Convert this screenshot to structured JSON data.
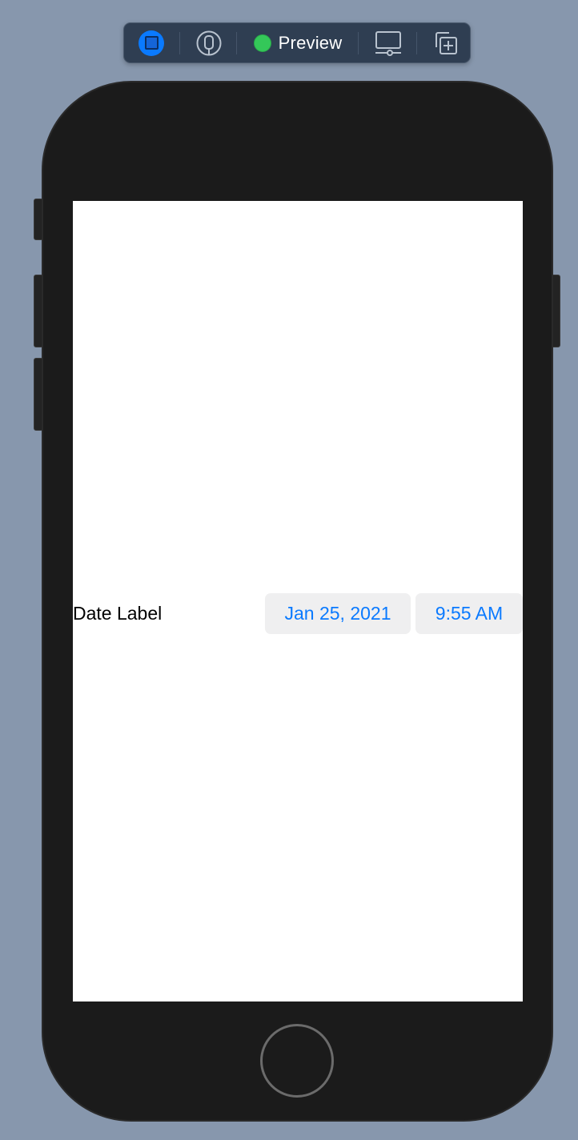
{
  "toolbar": {
    "items": [
      {
        "name": "live-preview",
        "icon": "stop-square-icon"
      },
      {
        "name": "on-device",
        "icon": "phone-device-icon"
      },
      {
        "name": "preview",
        "icon": "green-status-dot-icon",
        "label": "Preview"
      },
      {
        "name": "device-settings",
        "icon": "display-settings-icon"
      },
      {
        "name": "duplicate-preview",
        "icon": "add-duplicate-icon"
      }
    ]
  },
  "screen": {
    "date_label": "Date Label",
    "date_value": "Jan 25, 2021",
    "time_value": "9:55 AM"
  },
  "colors": {
    "background": "#8797ad",
    "toolbar": "#2f3e52",
    "accent_blue": "#0a7aff",
    "preview_green": "#34c759",
    "device_body": "#1b1b1b",
    "picker_background": "#efeff0"
  }
}
